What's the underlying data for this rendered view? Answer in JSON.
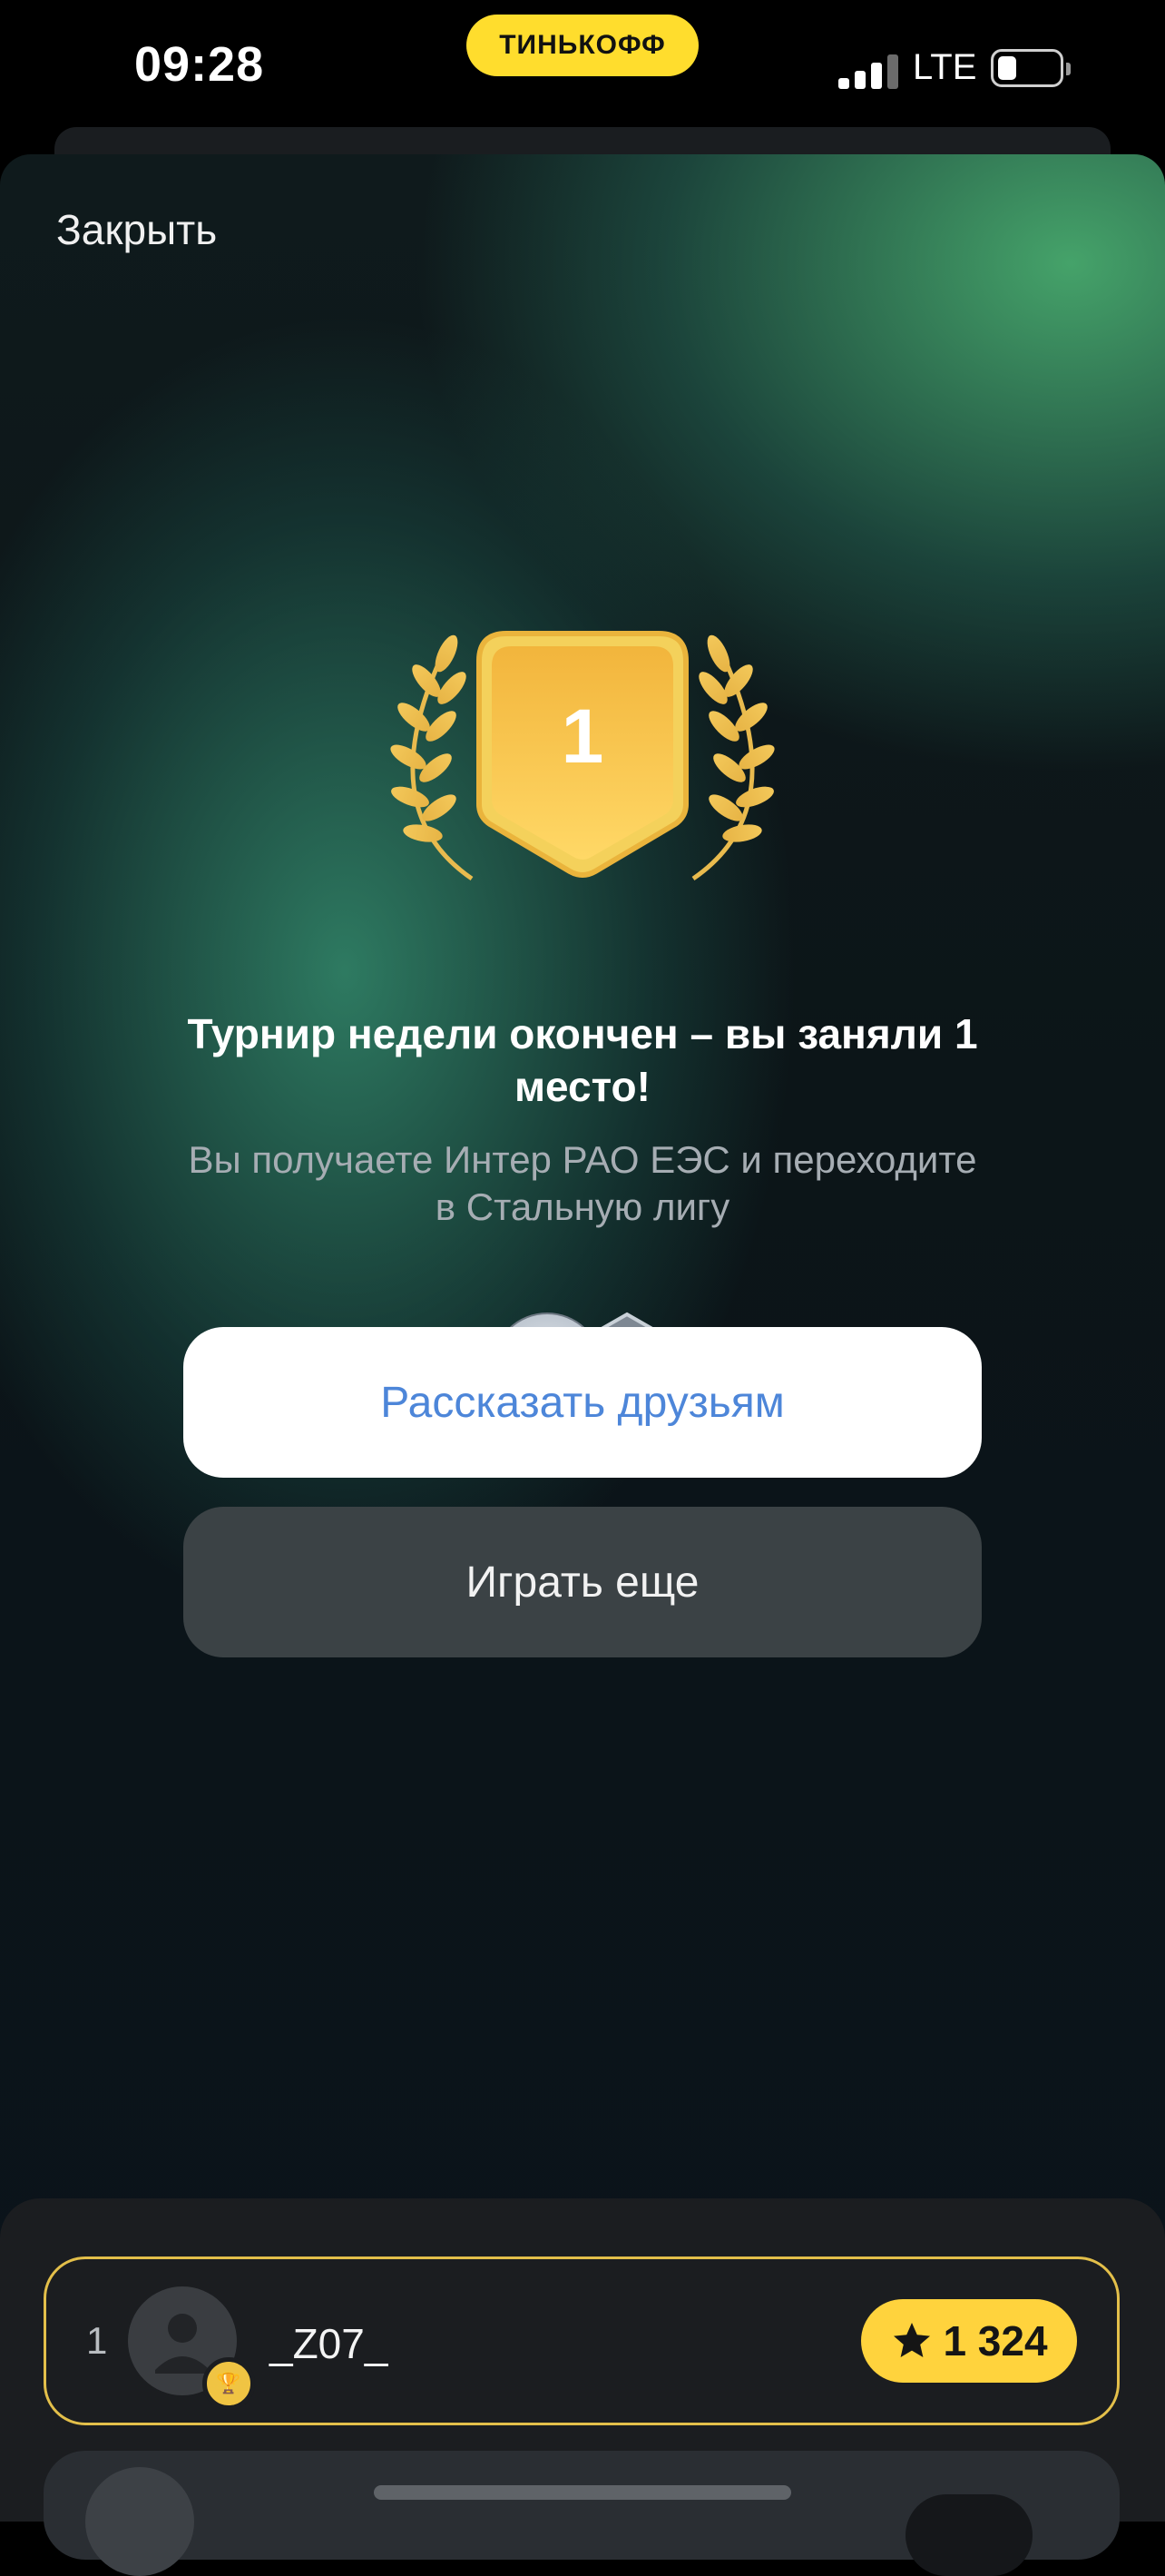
{
  "status_bar": {
    "time": "09:28",
    "brand": "ТИНЬКОФФ",
    "network": "LTE"
  },
  "modal": {
    "close_label": "Закрыть",
    "place_number": "1",
    "title": "Турнир недели окончен – вы заняли 1 место!",
    "subtitle": "Вы получаете Интер РАО ЕЭС и переходите в Стальную лигу",
    "share_button": "Рассказать друзьям",
    "play_again_button": "Играть еще"
  },
  "leaderboard": {
    "rows": [
      {
        "rank": "1",
        "name": "_Z07_",
        "score": "1 324"
      }
    ]
  },
  "colors": {
    "accent_yellow": "#ffd33d",
    "link_blue": "#4d86d9",
    "highlight_border": "#e3bf4a"
  }
}
